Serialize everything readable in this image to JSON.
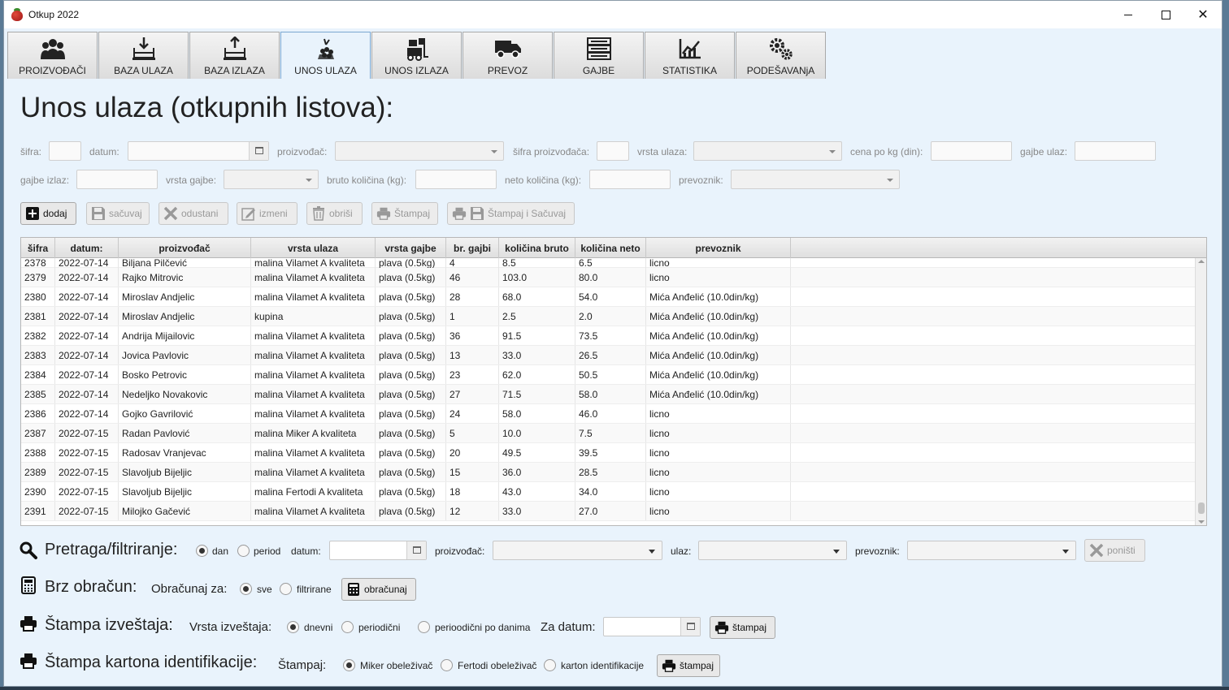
{
  "window": {
    "title": "Otkup 2022"
  },
  "tabs": [
    {
      "label": "PROIZVOĐAČI",
      "icon": "people-icon"
    },
    {
      "label": "BAZA ULAZA",
      "icon": "inbox-in-icon"
    },
    {
      "label": "BAZA IZLAZA",
      "icon": "inbox-out-icon"
    },
    {
      "label": "UNOS ULAZA",
      "icon": "berries-icon",
      "active": true
    },
    {
      "label": "UNOS IZLAZA",
      "icon": "forklift-icon"
    },
    {
      "label": "PREVOZ",
      "icon": "truck-icon"
    },
    {
      "label": "GAJBE",
      "icon": "crates-icon"
    },
    {
      "label": "STATISTIKA",
      "icon": "chart-icon"
    },
    {
      "label": "PODEŠAVANjA",
      "icon": "gears-icon"
    }
  ],
  "page": {
    "title": "Unos ulaza (otkupnih listova):"
  },
  "form": {
    "sifra": "šifra:",
    "datum": "datum:",
    "proizvodjac": "proizvođač:",
    "sifra_proizvodjaca": "šifra proizvođača:",
    "vrsta_ulaza": "vrsta ulaza:",
    "cena": "cena po kg (din):",
    "gajbe_ulaz": "gajbe ulaz:",
    "gajbe_izlaz": "gajbe izlaz:",
    "vrsta_gajbe": "vrsta gajbe:",
    "bruto": "bruto količina (kg):",
    "neto": "neto količina (kg):",
    "prevoznik": "prevoznik:"
  },
  "actions": {
    "dodaj": "dodaj",
    "sacuvaj": "sačuvaj",
    "odustani": "odustani",
    "izmeni": "izmeni",
    "obrisi": "obriši",
    "stampaj": "Štampaj",
    "stampaj_sacuvaj": "Štampaj i Sačuvaj"
  },
  "table": {
    "columns": [
      "šifra",
      "datum:",
      "proizvođač",
      "vrsta ulaza",
      "vrsta gajbe",
      "br. gajbi",
      "količina bruto",
      "količina neto",
      "prevoznik"
    ],
    "rows": [
      [
        "2378",
        "2022-07-14",
        "Biljana Pilčević",
        "malina Vilamet A kvaliteta",
        "plava  (0.5kg)",
        "4",
        "8.5",
        "6.5",
        "licno"
      ],
      [
        "2379",
        "2022-07-14",
        "Rajko Mitrovic",
        "malina Vilamet A kvaliteta",
        "plava  (0.5kg)",
        "46",
        "103.0",
        "80.0",
        "licno"
      ],
      [
        "2380",
        "2022-07-14",
        "Miroslav Andjelic",
        "malina Vilamet A kvaliteta",
        "plava  (0.5kg)",
        "28",
        "68.0",
        "54.0",
        "Mića Anđelić (10.0din/kg)"
      ],
      [
        "2381",
        "2022-07-14",
        "Miroslav Andjelic",
        "kupina",
        "plava  (0.5kg)",
        "1",
        "2.5",
        "2.0",
        "Mića Anđelić (10.0din/kg)"
      ],
      [
        "2382",
        "2022-07-14",
        "Andrija Mijailovic",
        "malina Vilamet A kvaliteta",
        "plava  (0.5kg)",
        "36",
        "91.5",
        "73.5",
        "Mića Anđelić (10.0din/kg)"
      ],
      [
        "2383",
        "2022-07-14",
        "Jovica Pavlovic",
        "malina Vilamet A kvaliteta",
        "plava  (0.5kg)",
        "13",
        "33.0",
        "26.5",
        "Mića Anđelić (10.0din/kg)"
      ],
      [
        "2384",
        "2022-07-14",
        "Bosko Petrovic",
        "malina Vilamet A kvaliteta",
        "plava  (0.5kg)",
        "23",
        "62.0",
        "50.5",
        "Mića Anđelić (10.0din/kg)"
      ],
      [
        "2385",
        "2022-07-14",
        "Nedeljko Novakovic",
        "malina Vilamet A kvaliteta",
        "plava  (0.5kg)",
        "27",
        "71.5",
        "58.0",
        "Mića Anđelić (10.0din/kg)"
      ],
      [
        "2386",
        "2022-07-14",
        "Gojko Gavrilović",
        "malina Vilamet A kvaliteta",
        "plava  (0.5kg)",
        "24",
        "58.0",
        "46.0",
        "licno"
      ],
      [
        "2387",
        "2022-07-15",
        "Radan Pavlović",
        "malina Miker A kvaliteta",
        "plava  (0.5kg)",
        "5",
        "10.0",
        "7.5",
        "licno"
      ],
      [
        "2388",
        "2022-07-15",
        "Radosav Vranjevac",
        "malina Vilamet A kvaliteta",
        "plava  (0.5kg)",
        "20",
        "49.5",
        "39.5",
        "licno"
      ],
      [
        "2389",
        "2022-07-15",
        "Slavoljub Bijeljic",
        "malina Vilamet A kvaliteta",
        "plava  (0.5kg)",
        "15",
        "36.0",
        "28.5",
        "licno"
      ],
      [
        "2390",
        "2022-07-15",
        "Slavoljub Bijeljic",
        "malina Fertodi A kvaliteta",
        "plava  (0.5kg)",
        "18",
        "43.0",
        "34.0",
        "licno"
      ],
      [
        "2391",
        "2022-07-15",
        "Milojko Gačević",
        "malina Vilamet A kvaliteta",
        "plava  (0.5kg)",
        "12",
        "33.0",
        "27.0",
        "licno"
      ]
    ]
  },
  "filter": {
    "title": "Pretraga/filtriranje:",
    "dan": "dan",
    "period": "period",
    "datum": "datum:",
    "proizvodjac": "proizvođač:",
    "ulaz": "ulaz:",
    "prevoznik": "prevoznik:",
    "ponisti": "poništi",
    "selected": "dan"
  },
  "calc": {
    "title": "Brz obračun:",
    "obracunaj_za": "Obračunaj za:",
    "sve": "sve",
    "filtrirane": "filtrirane",
    "button": "obračunaj",
    "selected": "sve"
  },
  "report": {
    "title": "Štampa izveštaja:",
    "vrsta": "Vrsta izveštaja:",
    "dnevni": "dnevni",
    "periodicni": "periodični",
    "po_danima": "perioodični po danima",
    "za_datum": "Za datum:",
    "button": "štampaj",
    "selected": "dnevni"
  },
  "card": {
    "title": "Štampa kartona identifikacije:",
    "stampaj": "Štampaj:",
    "miker": "Miker obeleživač",
    "fertodi": "Fertodi obeleživač",
    "karton": "karton identifikacije",
    "button": "štampaj",
    "selected": "miker"
  }
}
